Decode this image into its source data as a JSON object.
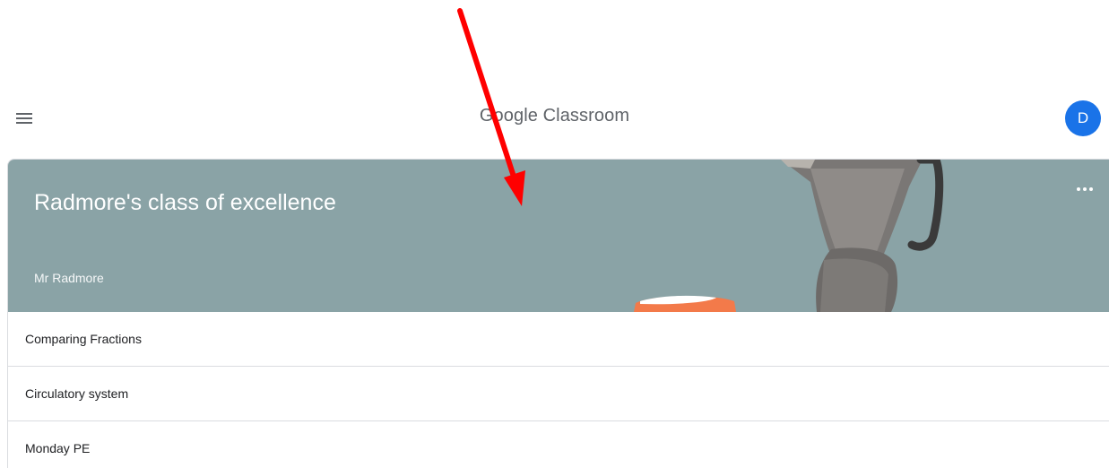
{
  "app_bar": {
    "title": "Google Classroom",
    "menu_icon": "hamburger-menu-icon",
    "avatar_letter": "D",
    "avatar_color": "#1a73e8"
  },
  "class_card": {
    "title": "Radmore's class of excellence",
    "teacher": "Mr Radmore",
    "banner_color": "#8aa3a6",
    "more_icon": "more-horizontal-icon",
    "topics": [
      {
        "label": "Comparing Fractions"
      },
      {
        "label": "Circulatory system"
      },
      {
        "label": "Monday PE"
      }
    ]
  },
  "annotation": {
    "type": "red-arrow",
    "color": "#ff0000"
  }
}
